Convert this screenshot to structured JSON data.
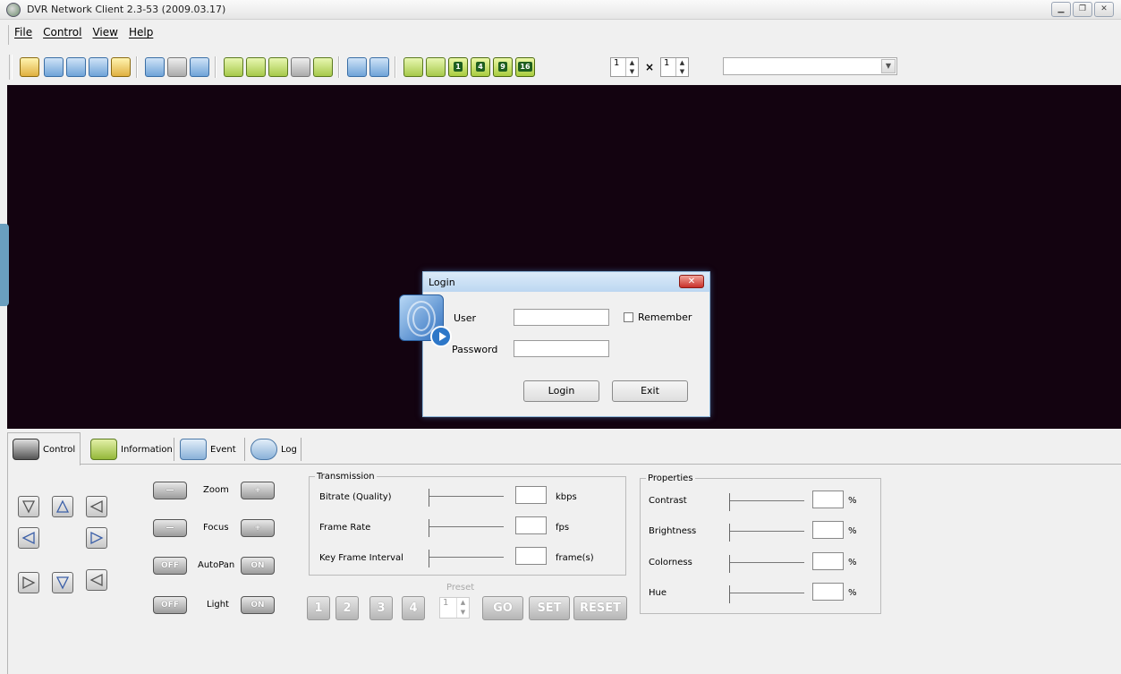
{
  "window": {
    "title": "DVR Network Client 2.3-53 (2009.03.17)"
  },
  "menu": [
    "File",
    "Control",
    "View",
    "Help"
  ],
  "toolbar": {
    "layout_buttons": [
      "1",
      "4",
      "9",
      "16"
    ],
    "grid_cols": "1",
    "grid_rows": "1",
    "times": "×",
    "combo_value": ""
  },
  "login": {
    "title": "Login",
    "close": "✕",
    "user_label": "User",
    "password_label": "Password",
    "remember_label": "Remember",
    "login_btn": "Login",
    "exit_btn": "Exit"
  },
  "tabs": [
    "Control",
    "Information",
    "Event",
    "Log"
  ],
  "ptz": {
    "zoom_label": "Zoom",
    "focus_label": "Focus",
    "autopan_label": "AutoPan",
    "light_label": "Light",
    "minus": "—",
    "plus": "+",
    "off": "OFF",
    "on": "ON"
  },
  "transmission": {
    "legend": "Transmission",
    "rows": [
      {
        "label": "Bitrate (Quality)",
        "unit": "kbps"
      },
      {
        "label": "Frame Rate",
        "unit": "fps"
      },
      {
        "label": "Key Frame Interval",
        "unit": "frame(s)"
      }
    ]
  },
  "preset": {
    "label": "Preset",
    "numbers": [
      "1",
      "2",
      "3",
      "4"
    ],
    "spin_value": "1",
    "go": "GO",
    "set": "SET",
    "reset": "RESET"
  },
  "properties": {
    "legend": "Properties",
    "rows": [
      {
        "label": "Contrast",
        "unit": "%"
      },
      {
        "label": "Brightness",
        "unit": "%"
      },
      {
        "label": "Colorness",
        "unit": "%"
      },
      {
        "label": "Hue",
        "unit": "%"
      }
    ]
  }
}
